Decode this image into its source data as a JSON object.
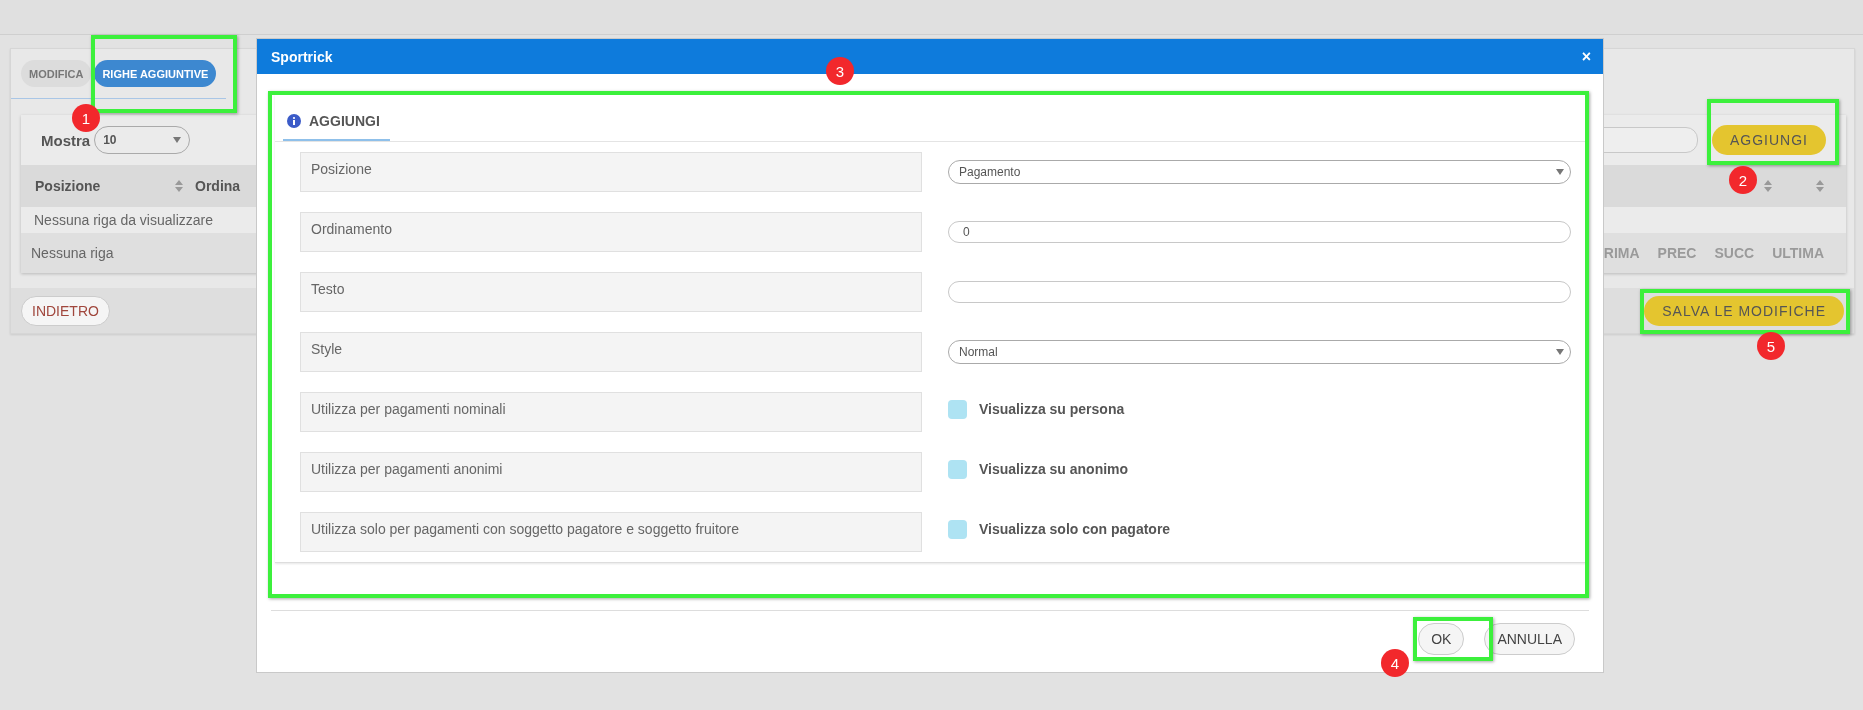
{
  "page": {
    "tabs": [
      {
        "label": "MODIFICA",
        "selected": false
      },
      {
        "label": "RIGHE AGGIUNTIVE",
        "selected": true
      }
    ],
    "show": {
      "label": "Mostra",
      "value": "10"
    },
    "add_button": "AGGIUNGI",
    "table": {
      "columns": [
        "Posizione",
        "Ordina"
      ],
      "empty_row": "Nessuna riga da visualizzare",
      "footer": "Nessuna riga",
      "pagination": [
        "RIMA",
        "PREC",
        "SUCC",
        "ULTIMA"
      ]
    },
    "back_button": "INDIETRO",
    "save_button": "SALVA LE MODIFICHE"
  },
  "dialog": {
    "title": "Sportrick",
    "close": "×",
    "tab": "AGGIUNGI",
    "rows": [
      {
        "label": "Posizione",
        "kind": "select",
        "value": "Pagamento"
      },
      {
        "label": "Ordinamento",
        "kind": "input",
        "value": "0"
      },
      {
        "label": "Testo",
        "kind": "input"
      },
      {
        "label": "Style",
        "kind": "select",
        "value": "Normal"
      },
      {
        "label": "Utilizza per pagamenti nominali",
        "kind": "checkbox",
        "text": "Visualizza su persona",
        "checked": false
      },
      {
        "label": "Utilizza per pagamenti anonimi",
        "kind": "checkbox",
        "text": "Visualizza su anonimo",
        "checked": false
      },
      {
        "label": "Utilizza solo per pagamenti con soggetto pagatore e soggetto fruitore",
        "kind": "checkbox",
        "text": "Visualizza solo con pagatore",
        "checked": false
      }
    ],
    "buttons": [
      "OK",
      "ANNULLA"
    ]
  },
  "annotations": [
    {
      "number": "1"
    },
    {
      "number": "2"
    },
    {
      "number": "3"
    },
    {
      "number": "4"
    },
    {
      "number": "5"
    }
  ]
}
